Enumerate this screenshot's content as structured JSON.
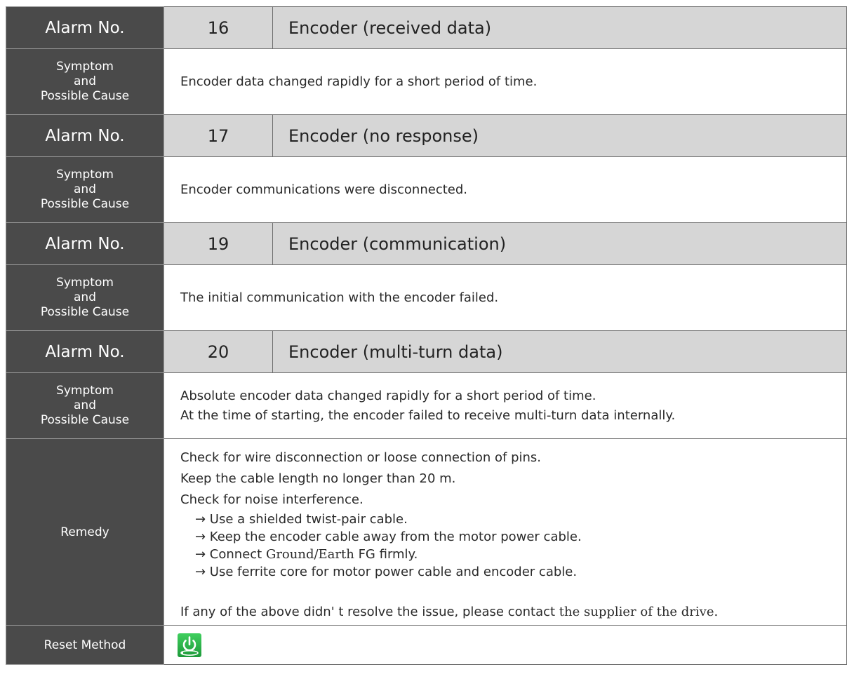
{
  "alarms": [
    {
      "label": "Alarm No.",
      "number": "16",
      "name": "Encoder (received data)",
      "symptom_label": [
        "Symptom",
        "and",
        "Possible Cause"
      ],
      "symptom_lines": [
        "Encoder data changed rapidly for a short period of time."
      ]
    },
    {
      "label": "Alarm No.",
      "number": "17",
      "name": "Encoder (no response)",
      "symptom_label": [
        "Symptom",
        "and",
        "Possible Cause"
      ],
      "symptom_lines": [
        "Encoder communications were disconnected."
      ]
    },
    {
      "label": "Alarm No.",
      "number": "19",
      "name": "Encoder (communication)",
      "symptom_label": [
        "Symptom",
        "and",
        "Possible Cause"
      ],
      "symptom_lines": [
        "The initial communication with the encoder failed."
      ]
    },
    {
      "label": "Alarm No.",
      "number": "20",
      "name": "Encoder (multi-turn data)",
      "symptom_label": [
        "Symptom",
        "and",
        "Possible Cause"
      ],
      "symptom_lines": [
        "Absolute encoder data changed rapidly for a short period of time.",
        "At the time of starting, the encoder failed to receive multi-turn data internally."
      ]
    }
  ],
  "remedy": {
    "label": "Remedy",
    "lines": [
      "Check for wire disconnection or loose connection of pins.",
      "Keep the cable length no longer than 20 m.",
      "Check for noise interference."
    ],
    "sub_items": {
      "shielded": "→ Use a shielded twist-pair cable.",
      "away": "→ Keep the encoder cable away from the motor power cable.",
      "connect_prefix": "→ Connect ",
      "connect_serif": "Ground/Earth",
      "connect_suffix": " FG firmly.",
      "ferrite": "→ Use ferrite core for motor power cable and encoder cable."
    },
    "closing_prefix": "If any of the above didn' t resolve the issue, please contact ",
    "closing_serif": "the supplier of the drive."
  },
  "reset": {
    "label": "Reset Method",
    "icon": "power-reset-icon",
    "icon_bg": "#2db84a"
  }
}
